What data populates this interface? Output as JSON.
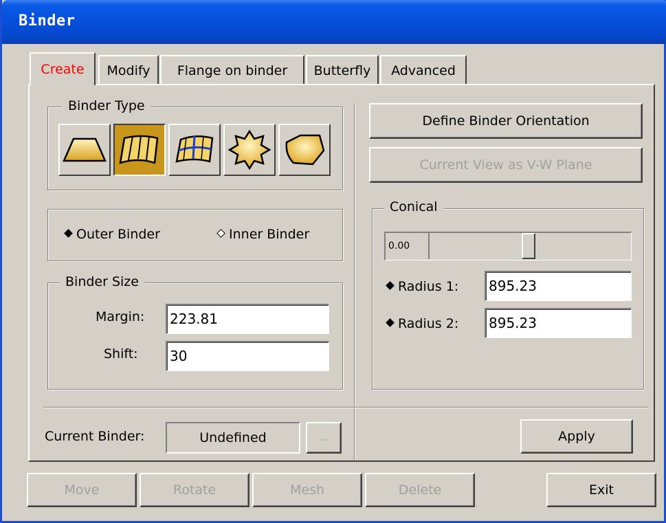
{
  "window": {
    "title": "Binder"
  },
  "tabs": [
    {
      "label": "Create",
      "active": true
    },
    {
      "label": "Modify",
      "active": false
    },
    {
      "label": "Flange on binder",
      "active": false
    },
    {
      "label": "Butterfly",
      "active": false
    },
    {
      "label": "Advanced",
      "active": false
    }
  ],
  "binder_type": {
    "label": "Binder Type",
    "buttons": [
      {
        "icon": "flat-binder-icon",
        "selected": false
      },
      {
        "icon": "curved-binder-icon",
        "selected": true
      },
      {
        "icon": "grid-binder-icon",
        "selected": false
      },
      {
        "icon": "star-binder-icon",
        "selected": false
      },
      {
        "icon": "freeform-binder-icon",
        "selected": false
      }
    ]
  },
  "binder_position": {
    "outer_label": "Outer Binder",
    "inner_label": "Inner Binder",
    "selected": "outer"
  },
  "binder_size": {
    "label": "Binder Size",
    "margin_label": "Margin:",
    "margin_value": "223.81",
    "shift_label": "Shift:",
    "shift_value": "30"
  },
  "current_binder": {
    "label": "Current Binder:",
    "value": "Undefined",
    "browse_label": "..."
  },
  "orientation": {
    "define_label": "Define Binder Orientation",
    "current_view_label": "Current View as V-W Plane"
  },
  "conical": {
    "label": "Conical",
    "slider_value": "0.00",
    "slider_fraction": 0.0,
    "radius1_label": "Radius 1:",
    "radius1_value": "895.23",
    "radius2_label": "Radius 2:",
    "radius2_value": "895.23"
  },
  "buttons": {
    "apply": "Apply",
    "move": "Move",
    "rotate": "Rotate",
    "mesh": "Mesh",
    "delete": "Delete",
    "exit": "Exit"
  },
  "colors": {
    "face": "#d4d0c8",
    "titlebar": "#0750dc",
    "selected_type": "#c8961a",
    "active_tab_text": "#ff0000",
    "disabled_text": "#a0a0a0"
  }
}
